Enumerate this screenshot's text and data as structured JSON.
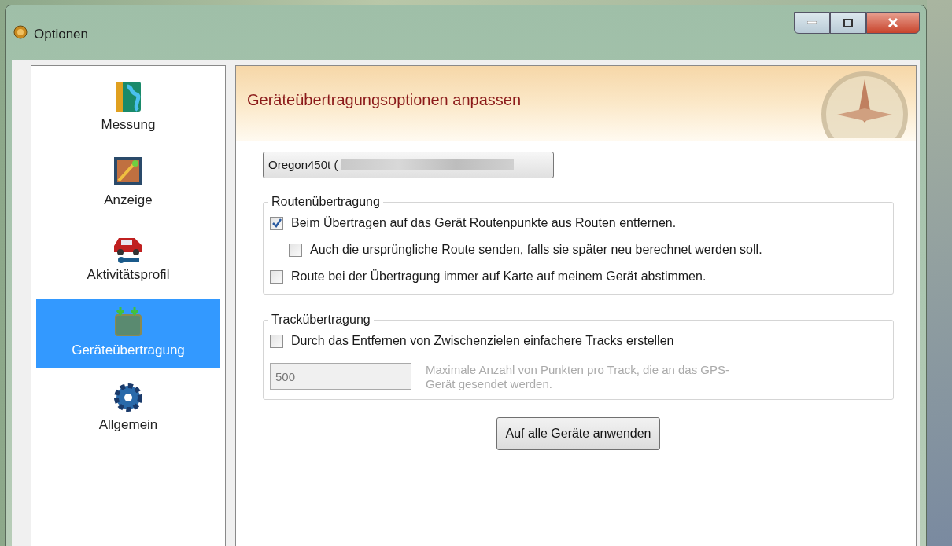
{
  "window": {
    "title": "Optionen"
  },
  "sidebar": {
    "items": [
      {
        "label": "Messung",
        "selected": false
      },
      {
        "label": "Anzeige",
        "selected": false
      },
      {
        "label": "Aktivitätsprofil",
        "selected": false
      },
      {
        "label": "Geräteübertragung",
        "selected": true
      },
      {
        "label": "Allgemein",
        "selected": false
      }
    ]
  },
  "header": {
    "title": "Geräteübertragungsoptionen anpassen"
  },
  "device_dropdown": {
    "value": "Oregon450t ("
  },
  "groups": [
    {
      "title": "Routenübertragung",
      "options": [
        {
          "label": "Beim Übertragen auf das Gerät Routenpunkte aus Routen entfernen.",
          "checked": true,
          "children": [
            {
              "label": "Auch die ursprüngliche Route senden, falls sie später neu berechnet werden soll.",
              "checked": false
            }
          ]
        },
        {
          "label": "Route bei der Übertragung immer auf Karte auf meinem Gerät abstimmen.",
          "checked": false
        }
      ]
    },
    {
      "title": "Trackübertragung",
      "options": [
        {
          "label": "Durch das Entfernen von Zwischenzielen einfachere Tracks erstellen",
          "checked": false
        }
      ],
      "field": {
        "value": "500",
        "disabled": true,
        "description": "Maximale Anzahl von Punkten pro Track, die an das GPS-Gerät gesendet werden."
      }
    }
  ],
  "apply_button": {
    "label": "Auf alle Geräte anwenden"
  }
}
